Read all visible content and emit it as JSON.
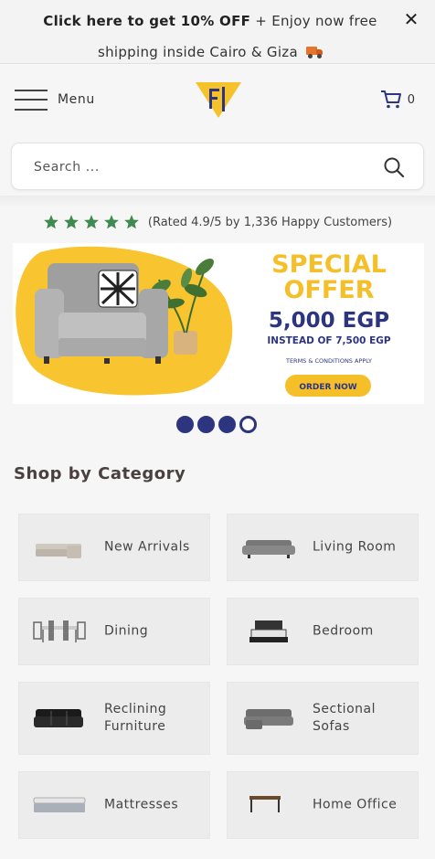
{
  "announcement": {
    "bold": "Click here to get 10% OFF",
    "rest": "+ Enjoy now free shipping inside Cairo & Giza",
    "close": "✕"
  },
  "header": {
    "menu_label": "Menu",
    "cart_count": "0"
  },
  "search": {
    "placeholder": "Search ..."
  },
  "rating": {
    "stars": 5,
    "text": "(Rated 4.9/5 by 1,336 Happy Customers)"
  },
  "banner": {
    "headline_1": "SPECIAL",
    "headline_2": "OFFER",
    "price": "5,000 EGP",
    "old_price": "INSTEAD OF 7,500 EGP",
    "terms": "TERMS & CONDITIONS APPLY",
    "cta": "ORDER NOW"
  },
  "carousel": {
    "total": 4,
    "active": 4
  },
  "categories": {
    "title": "Shop by Category",
    "items": [
      {
        "label": "New Arrivals",
        "icon": "sectional-sofa-photo"
      },
      {
        "label": "Living Room",
        "icon": "sofa-photo"
      },
      {
        "label": "Dining",
        "icon": "dining-set-photo"
      },
      {
        "label": "Bedroom",
        "icon": "bed-photo"
      },
      {
        "label": "Reclining\nFurniture",
        "icon": "recliner-photo"
      },
      {
        "label": "Sectional\nSofas",
        "icon": "sectional-photo"
      },
      {
        "label": "Mattresses",
        "icon": "mattress-photo"
      },
      {
        "label": "Home Office",
        "icon": "desk-photo"
      }
    ]
  },
  "colors": {
    "brand_yellow": "#f5c22b",
    "brand_navy": "#2d3580",
    "star_green": "#3f8a4e",
    "tile_bg": "#ececec"
  }
}
